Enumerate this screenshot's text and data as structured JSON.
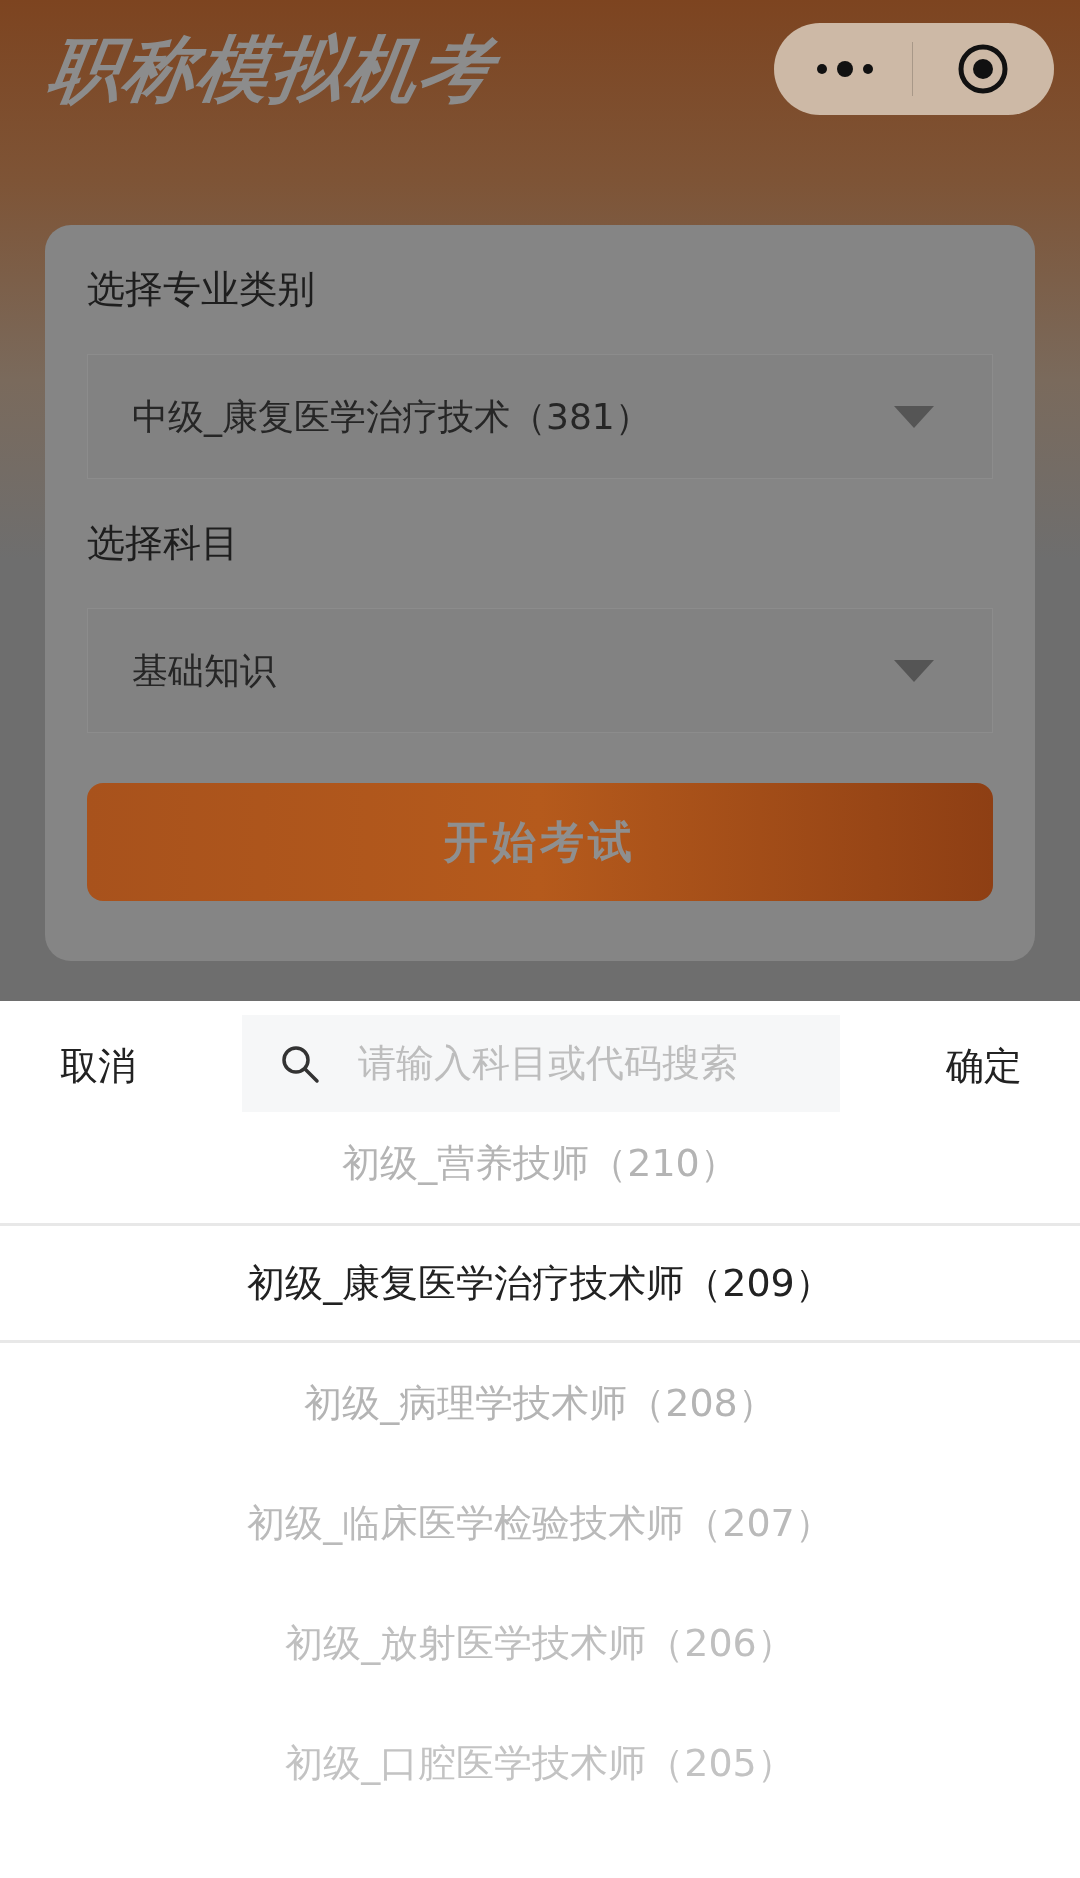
{
  "header": {
    "title": "职称模拟机考"
  },
  "form": {
    "fields": [
      {
        "label": "选择专业类别",
        "value": "中级_康复医学治疗技术（381）"
      },
      {
        "label": "选择科目",
        "value": "基础知识"
      }
    ],
    "submit": "开始考试"
  },
  "picker": {
    "cancel": "取消",
    "search": {
      "placeholder": "请输入科目或代码搜索"
    },
    "confirm": "确定",
    "options": [
      {
        "label": "初级_营养技师（210）",
        "selected": false
      },
      {
        "label": "初级_康复医学治疗技术师（209）",
        "selected": true
      },
      {
        "label": "初级_病理学技术师（208）",
        "selected": false
      },
      {
        "label": "初级_临床医学检验技术师（207）",
        "selected": false
      },
      {
        "label": "初级_放射医学技术师（206）",
        "selected": false
      },
      {
        "label": "初级_口腔医学技术师（205）",
        "selected": false
      }
    ]
  }
}
